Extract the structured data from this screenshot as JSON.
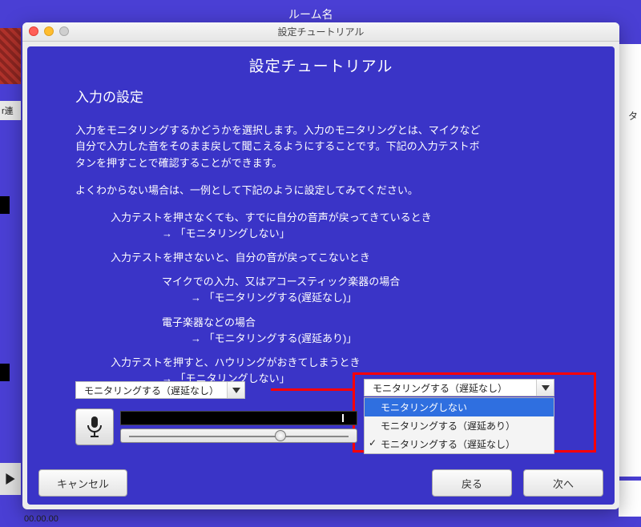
{
  "background": {
    "room_label": "ルーム名",
    "right_panel_label": "タ",
    "left_edit_label": "r連",
    "timer_text": "00.00.00"
  },
  "window": {
    "titlebar": "設定チュートリアル"
  },
  "tutorial": {
    "title": "設定チュートリアル",
    "section_head": "入力の設定",
    "intro_l1": "入力をモニタリングするかどうかを選択します。入力のモニタリングとは、マイクなど",
    "intro_l2": "自分で入力した音をそのまま戻して聞こえるようにすることです。下記の入力テストボ",
    "intro_l3": "タンを押すことで確認することができます。",
    "hint": "よくわからない場合は、一例として下記のように設定してみてください。",
    "case1_l1": "入力テストを押さなくても、すでに自分の音声が戻ってきているとき",
    "case1_l2": "→ 「モニタリングしない」",
    "case2_l1": "入力テストを押さないと、自分の音が戻ってこないとき",
    "case2_sub1_l1": "マイクでの入力、又はアコースティック楽器の場合",
    "case2_sub1_l2": "→ 「モニタリングする(遅延なし)」",
    "case2_sub2_l1": "電子楽器などの場合",
    "case2_sub2_l2": "→ 「モニタリングする(遅延あり)」",
    "case3_l1": "入力テストを押すと、ハウリングがおきてしまうとき",
    "case3_l2": "→ 「モニタリングしない」"
  },
  "monitoring_select": {
    "current": "モニタリングする（遅延なし）"
  },
  "popup_select": {
    "current": "モニタリングする（遅延なし）",
    "options": {
      "none": "モニタリングしない",
      "delay": "モニタリングする（遅延あり）",
      "nodelay": "モニタリングする（遅延なし）"
    },
    "checkmark": "✓"
  },
  "buttons": {
    "cancel": "キャンセル",
    "back": "戻る",
    "next": "次へ"
  }
}
